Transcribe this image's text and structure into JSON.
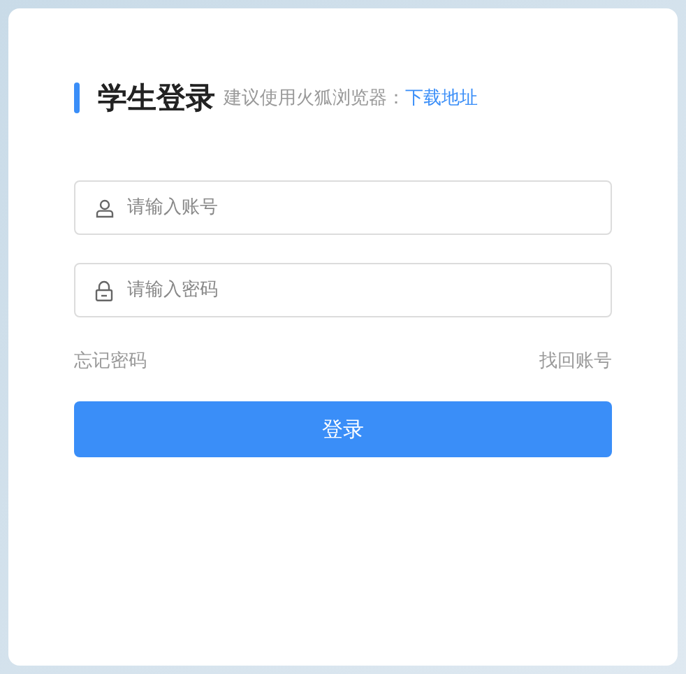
{
  "header": {
    "title": "学生登录",
    "hint": "建议使用火狐浏览器：",
    "link": "下载地址"
  },
  "fields": [
    {
      "kind": "user",
      "placeholder": "请输入账号"
    },
    {
      "kind": "lock",
      "placeholder": "请输入密码"
    }
  ],
  "links": [
    "忘记密码",
    "找回账号"
  ],
  "button": "登录"
}
